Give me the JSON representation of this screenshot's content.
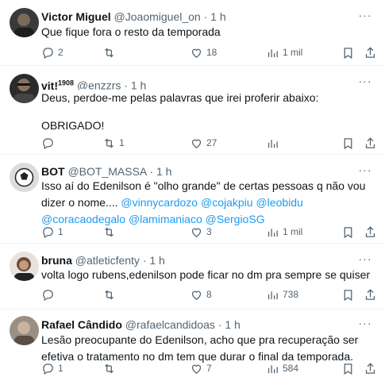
{
  "icons": {
    "reply": "reply-icon",
    "retweet": "retweet-icon",
    "like": "heart-icon",
    "views": "views-icon",
    "bookmark": "bookmark-icon",
    "share": "share-icon",
    "more": "more-icon"
  },
  "colors": {
    "text": "#0f1419",
    "muted": "#536471",
    "link": "#1d9bf0",
    "divider": "#eff3f4"
  },
  "more_glyph": "···",
  "separator": "·",
  "tweets": [
    {
      "name": "Victor Miguel",
      "handle": "@Joaomiguel_on",
      "time": "1 h",
      "text": "Que fique fora o resto da temporada",
      "replies": "2",
      "retweets": "",
      "likes": "18",
      "views": "1 mil"
    },
    {
      "name": "vit!",
      "name_sup": "1908",
      "handle": "@enzzrs",
      "time": "1 h",
      "lines": [
        "Deus, perdoe-me pelas palavras que irei proferir abaixo:",
        "OBRIGADO!"
      ],
      "replies": "",
      "retweets": "1",
      "likes": "27",
      "views": ""
    },
    {
      "name": "BOT",
      "handle": "@BOT_MASSA",
      "time": "1 h",
      "text_a": "Isso aí do Edenilson é \"olho grande\" de certas pessoas q não vou dizer o nome.... ",
      "mentions": [
        "@vinnycardozo",
        "@cojakpiu",
        "@leobidu",
        "@coracaodegalo",
        "@lamimaniaco",
        "@SergioSG"
      ],
      "replies": "1",
      "retweets": "",
      "likes": "3",
      "views": "1 mil"
    },
    {
      "name": "bruna",
      "handle": "@atleticfenty",
      "time": "1 h",
      "text": "volta logo rubens,edenilson pode ficar no dm pra sempre se quiser",
      "replies": "",
      "retweets": "",
      "likes": "8",
      "views": "738"
    },
    {
      "name": "Rafael Cândido",
      "handle": "@rafaelcandidoas",
      "time": "1 h",
      "text": "Lesão preocupante do Edenilson, acho que pra recuperação ser efetiva o tratamento no dm tem que durar o final da temporada.",
      "replies": "1",
      "retweets": "",
      "likes": "7",
      "views": "584"
    }
  ]
}
